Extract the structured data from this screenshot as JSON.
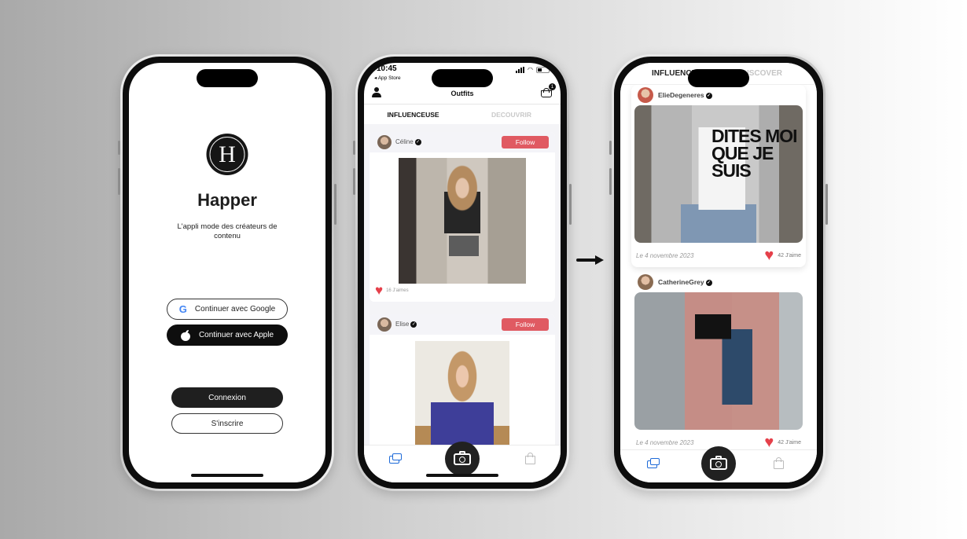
{
  "login_screen": {
    "logo_letter": "H",
    "app_name": "Happer",
    "tagline": "L'appli mode des créateurs de contenu",
    "google_button": "Continuer avec Google",
    "apple_button": "Continuer avec Apple",
    "login_button": "Connexion",
    "signup_button": "S'inscrire"
  },
  "feed_screen": {
    "status": {
      "time": "10:45",
      "back_label": "◂ App Store"
    },
    "header_title": "Outfits",
    "basket_count": "1",
    "tabs": {
      "influencer": "INFLUENCEUSE",
      "discover": "DECOUVRIR"
    },
    "posts": [
      {
        "name": "Céline",
        "follow_label": "Follow",
        "likes": "16 J'aimes"
      },
      {
        "name": "Elise",
        "follow_label": "Follow"
      }
    ]
  },
  "discover_screen": {
    "tabs": {
      "influencer": "INFLUENCEUSE",
      "discover": "DISCOVER"
    },
    "posts": [
      {
        "name": "ElieDegeneres",
        "shirt_text": "DITES MOI QUE JE SUIS",
        "date": "Le 4 novembre 2023",
        "likes": "42 J'aime"
      },
      {
        "name": "CatherineGrey",
        "date": "Le 4 novembre 2023",
        "likes": "42 J'aime"
      }
    ]
  },
  "colors": {
    "follow": "#e05a62",
    "heart": "#e5404a",
    "nav_active": "#1e6ad8",
    "dark": "#1f1f1f"
  }
}
